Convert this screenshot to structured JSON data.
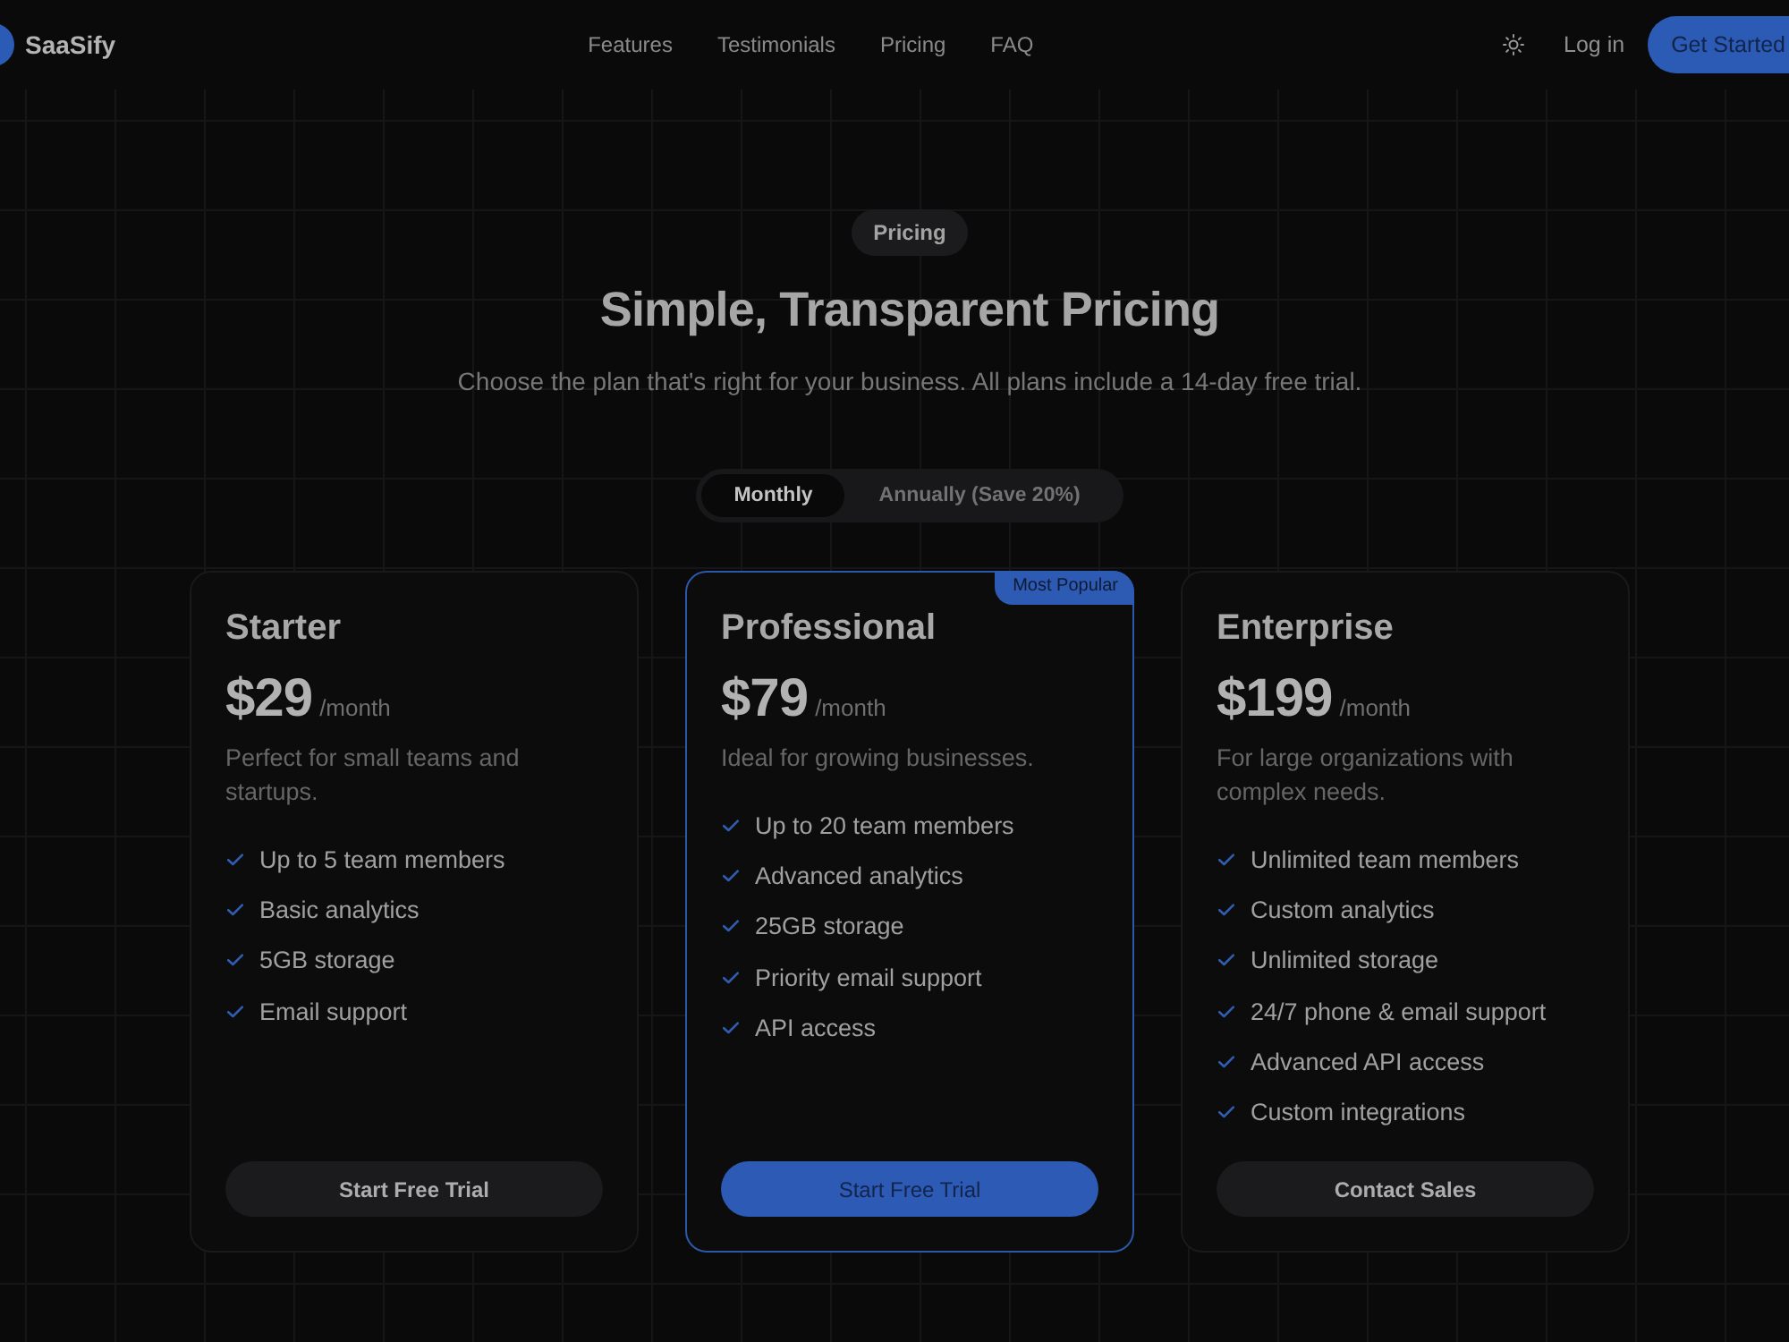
{
  "nav": {
    "logo": "SaaSify",
    "links": [
      "Features",
      "Testimonials",
      "Pricing",
      "FAQ"
    ],
    "login": "Log in",
    "cta": "Get Started"
  },
  "hero": {
    "badge": "Pricing",
    "title": "Simple, Transparent Pricing",
    "subtitle": "Choose the plan that's right for your business. All plans include a 14-day free trial."
  },
  "billing_toggle": [
    {
      "label": "Monthly",
      "selected": true
    },
    {
      "label": "Annually (Save 20%)",
      "selected": false
    }
  ],
  "plans": [
    {
      "name": "Starter",
      "price": "$29",
      "period": "/month",
      "description": "Perfect for small teams and startups.",
      "features": [
        "Up to 5 team members",
        "Basic analytics",
        "5GB storage",
        "Email support"
      ],
      "button": "Start Free Trial",
      "featured": false
    },
    {
      "name": "Professional",
      "badge": "Most Popular",
      "price": "$79",
      "period": "/month",
      "description": "Ideal for growing businesses.",
      "features": [
        "Up to 20 team members",
        "Advanced analytics",
        "25GB storage",
        "Priority email support",
        "API access"
      ],
      "button": "Start Free Trial",
      "featured": true
    },
    {
      "name": "Enterprise",
      "price": "$199",
      "period": "/month",
      "description": "For large organizations with complex needs.",
      "features": [
        "Unlimited team members",
        "Custom analytics",
        "Unlimited storage",
        "24/7 phone & email support",
        "Advanced API access",
        "Custom integrations"
      ],
      "button": "Contact Sales",
      "featured": false
    }
  ]
}
